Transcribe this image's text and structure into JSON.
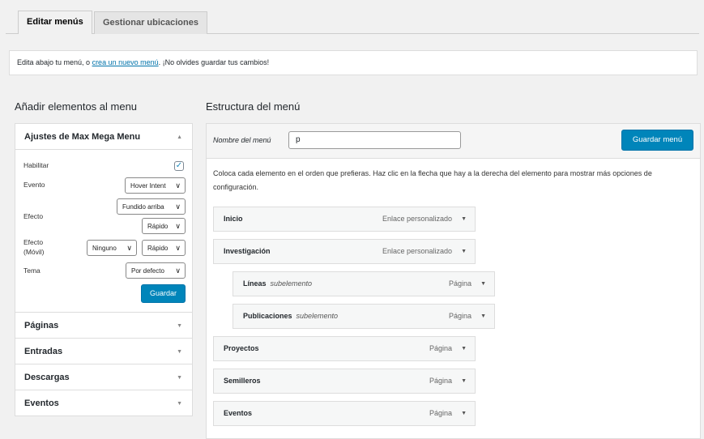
{
  "tabs": [
    {
      "label": "Editar menús",
      "active": true
    },
    {
      "label": "Gestionar ubicaciones",
      "active": false
    }
  ],
  "notice": {
    "before": "Edita abajo tu menú, o ",
    "link": "crea un nuevo menú",
    "after": ". ¡No olvides guardar tus cambios!"
  },
  "left": {
    "title": "Añadir elementos al menu",
    "max_mega_menu": {
      "title": "Ajustes de Max Mega Menu",
      "habilitar_label": "Habilitar",
      "habilitar_checked": true,
      "evento_label": "Evento",
      "evento_value": "Hover Intent",
      "efecto_label": "Efecto",
      "efecto_value": "Fundido arriba",
      "efecto_speed": "Rápido",
      "efecto_movil_label_1": "Efecto",
      "efecto_movil_label_2": "(Móvil)",
      "efecto_movil_value": "Ninguno",
      "efecto_movil_speed": "Rápido",
      "tema_label": "Tema",
      "tema_value": "Por defecto",
      "guardar_label": "Guardar"
    },
    "sections": [
      "Páginas",
      "Entradas",
      "Descargas",
      "Eventos"
    ]
  },
  "right": {
    "title": "Estructura del menú",
    "menu_name_label": "Nombre del menú",
    "menu_name_value": "p",
    "save_label": "Guardar menú",
    "instructions": "Coloca cada elemento en el orden que prefieras. Haz clic en la flecha que hay a la derecha del elemento para mostrar más opciones de configuración.",
    "items": [
      {
        "title": "Inicio",
        "sub": "",
        "type": "Enlace personalizado"
      },
      {
        "title": "Investigación",
        "sub": "",
        "type": "Enlace personalizado"
      },
      {
        "title": "Líneas",
        "sub": "subelemento",
        "type": "Página"
      },
      {
        "title": "Publicaciones",
        "sub": "subelemento",
        "type": "Página"
      },
      {
        "title": "Proyectos",
        "sub": "",
        "type": "Página"
      },
      {
        "title": "Semilleros",
        "sub": "",
        "type": "Página"
      },
      {
        "title": "Eventos",
        "sub": "",
        "type": "Página"
      }
    ]
  },
  "colors": {
    "accent": "#0085ba",
    "link": "#0073aa",
    "checkmark": "#1e8cbe"
  },
  "icons": {
    "dropdown": "chevron-down-icon",
    "collapse": "triangle-up-icon",
    "expand": "triangle-down-icon",
    "check": "checkmark-icon"
  }
}
